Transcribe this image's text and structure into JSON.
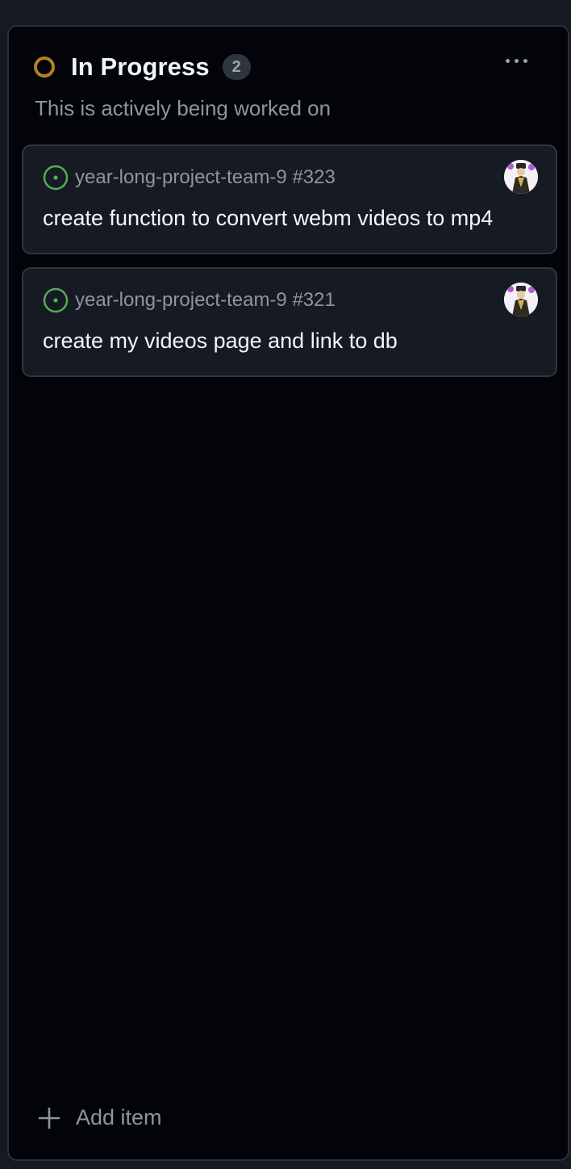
{
  "column": {
    "title": "In Progress",
    "count": "2",
    "description": "This is actively being worked on",
    "status_color": "#b57f1f",
    "menu_icon": "kebab-horizontal-icon"
  },
  "cards": [
    {
      "repo_ref": "year-long-project-team-9 #323",
      "title": "create function to convert webm videos to mp4",
      "state_icon": "issue-opened-icon",
      "state_color": "#57ab5a"
    },
    {
      "repo_ref": "year-long-project-team-9 #321",
      "title": "create my videos page and link to db",
      "state_icon": "issue-opened-icon",
      "state_color": "#57ab5a"
    }
  ],
  "footer": {
    "add_label": "Add item",
    "add_icon": "plus-icon"
  }
}
